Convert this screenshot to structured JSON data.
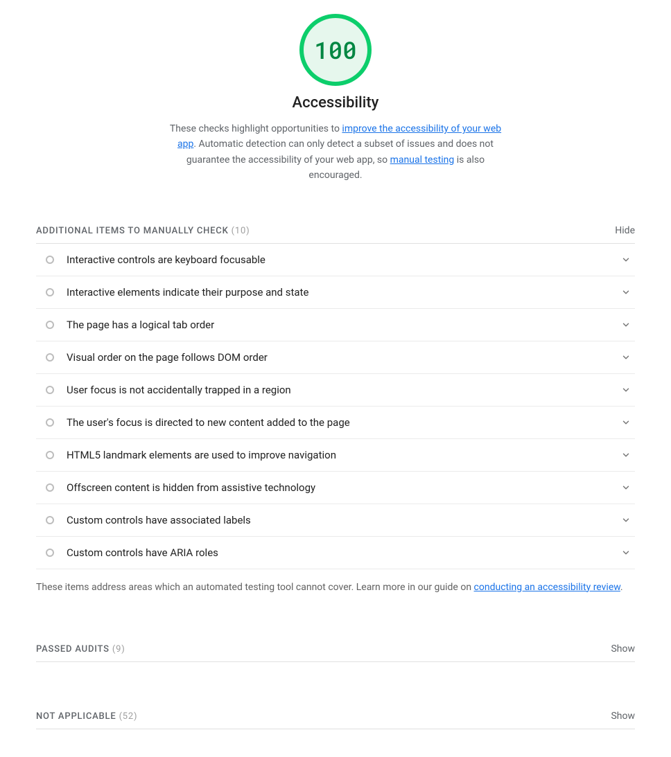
{
  "header": {
    "score": "100",
    "title": "Accessibility",
    "desc_pre": "These checks highlight opportunities to ",
    "link1": "improve the accessibility of your web app",
    "desc_mid": ". Automatic detection can only detect a subset of issues and does not guarantee the accessibility of your web app, so ",
    "link2": "manual testing",
    "desc_post": " is also encouraged."
  },
  "manual": {
    "heading": "ADDITIONAL ITEMS TO MANUALLY CHECK",
    "count": "(10)",
    "toggle": "Hide",
    "items": [
      "Interactive controls are keyboard focusable",
      "Interactive elements indicate their purpose and state",
      "The page has a logical tab order",
      "Visual order on the page follows DOM order",
      "User focus is not accidentally trapped in a region",
      "The user's focus is directed to new content added to the page",
      "HTML5 landmark elements are used to improve navigation",
      "Offscreen content is hidden from assistive technology",
      "Custom controls have associated labels",
      "Custom controls have ARIA roles"
    ],
    "footnote_pre": "These items address areas which an automated testing tool cannot cover. Learn more in our guide on ",
    "footnote_link": "conducting an accessibility review",
    "footnote_post": "."
  },
  "passed": {
    "heading": "PASSED AUDITS",
    "count": "(9)",
    "toggle": "Show"
  },
  "na": {
    "heading": "NOT APPLICABLE",
    "count": "(52)",
    "toggle": "Show"
  }
}
